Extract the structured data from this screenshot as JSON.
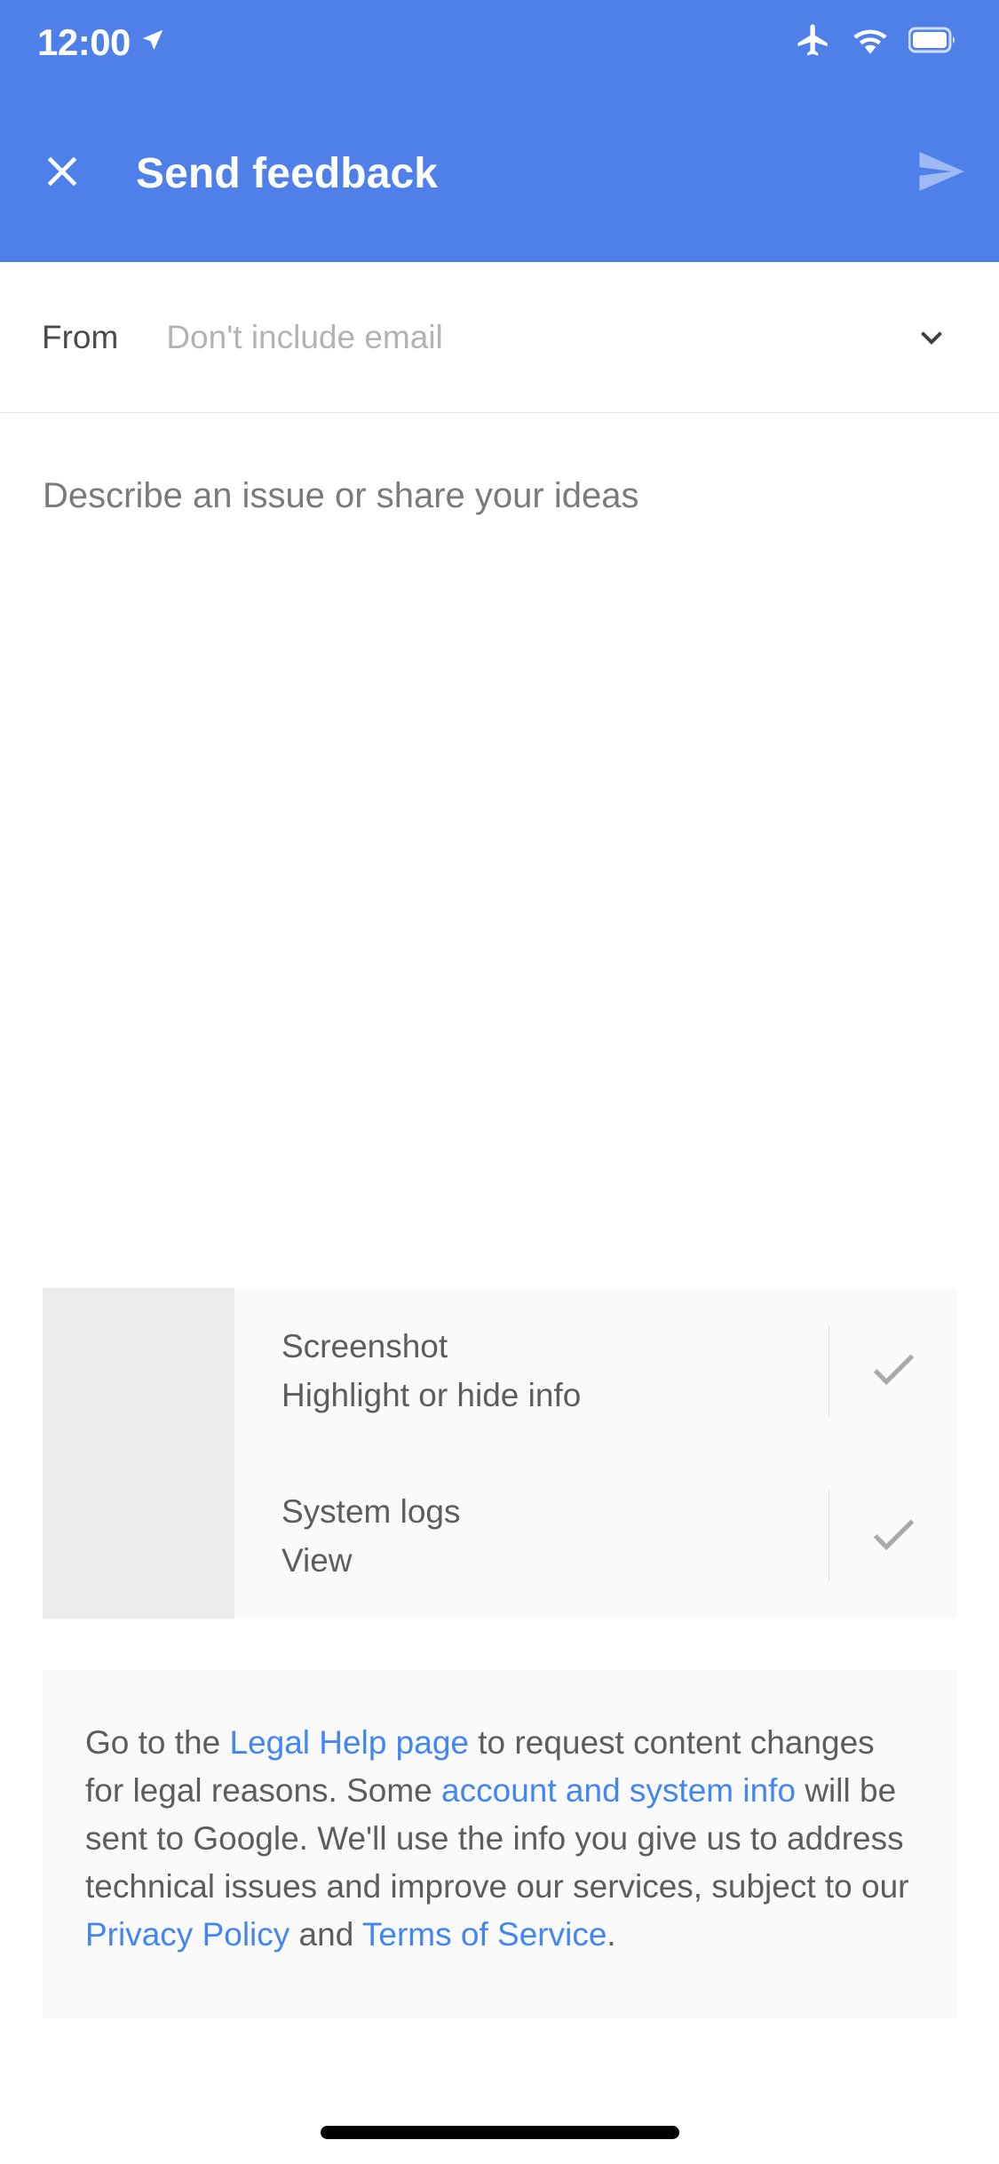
{
  "status_bar": {
    "time": "12:00",
    "location_icon": "location-arrow-icon",
    "airplane_icon": "airplane-mode-icon",
    "wifi_icon": "wifi-icon",
    "battery_icon": "battery-full-icon"
  },
  "app_bar": {
    "close_icon": "close-icon",
    "title": "Send feedback",
    "send_icon": "send-icon",
    "background_color": "#4F80EA"
  },
  "from_row": {
    "label": "From",
    "value": "Don't include email",
    "chevron_icon": "chevron-down-icon"
  },
  "description": {
    "placeholder": "Describe an issue or share your ideas",
    "value": ""
  },
  "attachments": [
    {
      "title": "Screenshot",
      "subtitle": "Highlight or hide info",
      "checked": true,
      "check_icon": "check-icon"
    },
    {
      "title": "System logs",
      "subtitle": "View",
      "checked": true,
      "check_icon": "check-icon"
    }
  ],
  "legal": {
    "part1": "Go to the ",
    "link1": "Legal Help page",
    "part2": " to request content changes for legal reasons. Some ",
    "link2": "account and system info",
    "part3": " will be sent to Google. We'll use the info you give us to address technical issues and improve our services, subject to our ",
    "link3": "Privacy Policy",
    "part4": " and ",
    "link4": "Terms of Service",
    "part5": ".",
    "link_color": "#4285F4"
  },
  "home_indicator": {
    "label": "home-indicator"
  }
}
